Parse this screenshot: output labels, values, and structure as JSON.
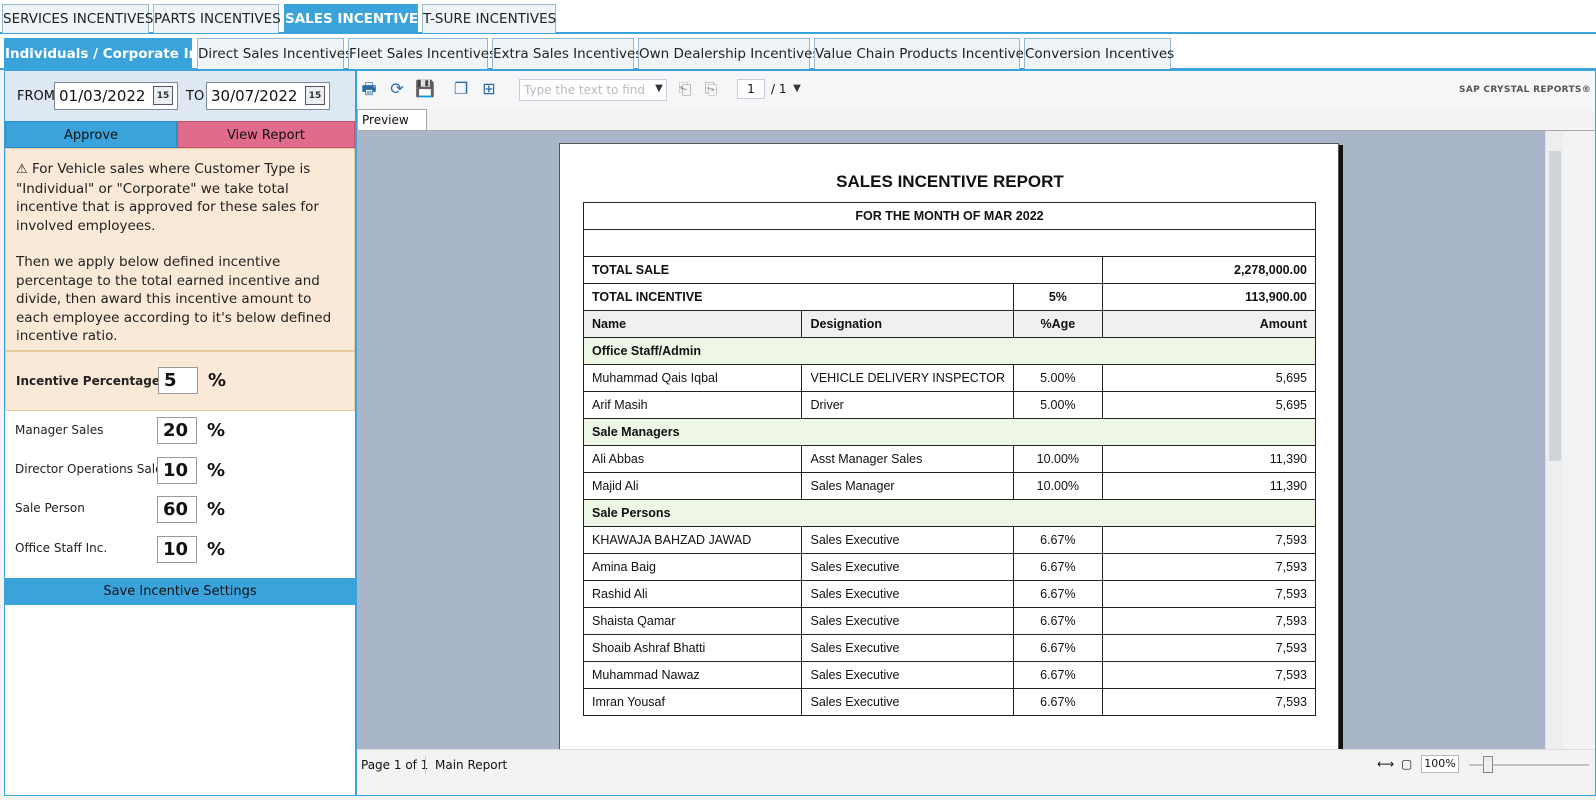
{
  "top_tabs": [
    "SERVICES INCENTIVES",
    "PARTS INCENTIVES",
    "SALES INCENTIVES",
    "T-SURE INCENTIVES"
  ],
  "sub_tabs": [
    "Individuals / Corporate Inc.",
    "Direct Sales Incentives",
    "Fleet Sales Incentives",
    "Extra Sales Incentives",
    "Own Dealership Incentives",
    "Value Chain Products Incentives",
    "Conversion Incentives"
  ],
  "filters": {
    "from_label": "FROM",
    "from_date": "01/03/2022",
    "to_label": "TO",
    "to_date": "30/07/2022",
    "cal_icon_text": "15"
  },
  "actions": {
    "approve": "Approve",
    "view_report": "View Report",
    "save": "Save Incentive Settings"
  },
  "note": {
    "para1": "For Vehicle sales where Customer Type is \"Individual\" or \"Corporate\" we take total incentive that is approved for these sales for involved employees.",
    "para2": "Then we apply below defined incentive percentage to the total earned incentive and divide, then award this incentive amount to each employee according to it's below defined incentive ratio."
  },
  "settings": {
    "incentive_percentage": {
      "label": "Incentive Percentage",
      "value": "5",
      "unit": "%"
    },
    "manager_sales": {
      "label": "Manager Sales",
      "value": "20",
      "unit": "%"
    },
    "director_ops": {
      "label": "Director Operations Sales",
      "value": "10",
      "unit": "%"
    },
    "sale_person": {
      "label": "Sale Person",
      "value": "60",
      "unit": "%"
    },
    "office_staff": {
      "label": "Office Staff Inc.",
      "value": "10",
      "unit": "%"
    }
  },
  "viewer": {
    "find_placeholder": "Type the text to find",
    "page_input": "1",
    "page_total": "/ 1",
    "brand": "SAP CRYSTAL REPORTS®",
    "preview_tab": "Preview",
    "status_page": "Page 1 of 1",
    "status_report": "Main Report",
    "zoom": "100%"
  },
  "report": {
    "title": "SALES INCENTIVE REPORT",
    "month": "FOR THE MONTH OF MAR 2022",
    "total_sale_label": "TOTAL SALE",
    "total_sale_value": "2,278,000.00",
    "total_incentive_label": "TOTAL INCENTIVE",
    "total_incentive_pct": "5%",
    "total_incentive_value": "113,900.00",
    "headers": {
      "name": "Name",
      "designation": "Designation",
      "pct": "%Age",
      "amount": "Amount"
    },
    "groups": [
      {
        "name": "Office Staff/Admin",
        "rows": [
          {
            "name": "Muhammad Qais Iqbal",
            "designation": "VEHICLE DELIVERY INSPECTOR",
            "pct": "5.00%",
            "amount": "5,695"
          },
          {
            "name": "Arif Masih",
            "designation": "Driver",
            "pct": "5.00%",
            "amount": "5,695"
          }
        ]
      },
      {
        "name": "Sale Managers",
        "rows": [
          {
            "name": "Ali Abbas",
            "designation": "Asst Manager Sales",
            "pct": "10.00%",
            "amount": "11,390"
          },
          {
            "name": "Majid Ali",
            "designation": "Sales Manager",
            "pct": "10.00%",
            "amount": "11,390"
          }
        ]
      },
      {
        "name": "Sale Persons",
        "rows": [
          {
            "name": "KHAWAJA BAHZAD JAWAD",
            "designation": "Sales Executive",
            "pct": "6.67%",
            "amount": "7,593"
          },
          {
            "name": "Amina Baig",
            "designation": "Sales Executive",
            "pct": "6.67%",
            "amount": "7,593"
          },
          {
            "name": "Rashid Ali",
            "designation": "Sales Executive",
            "pct": "6.67%",
            "amount": "7,593"
          },
          {
            "name": "Shaista Qamar",
            "designation": "Sales Executive",
            "pct": "6.67%",
            "amount": "7,593"
          },
          {
            "name": "Shoaib Ashraf Bhatti",
            "designation": "Sales Executive",
            "pct": "6.67%",
            "amount": "7,593"
          },
          {
            "name": "Muhammad Nawaz",
            "designation": "Sales Executive",
            "pct": "6.67%",
            "amount": "7,593"
          },
          {
            "name": "Imran Yousaf",
            "designation": "Sales Executive",
            "pct": "6.67%",
            "amount": "7,593"
          }
        ]
      }
    ]
  }
}
